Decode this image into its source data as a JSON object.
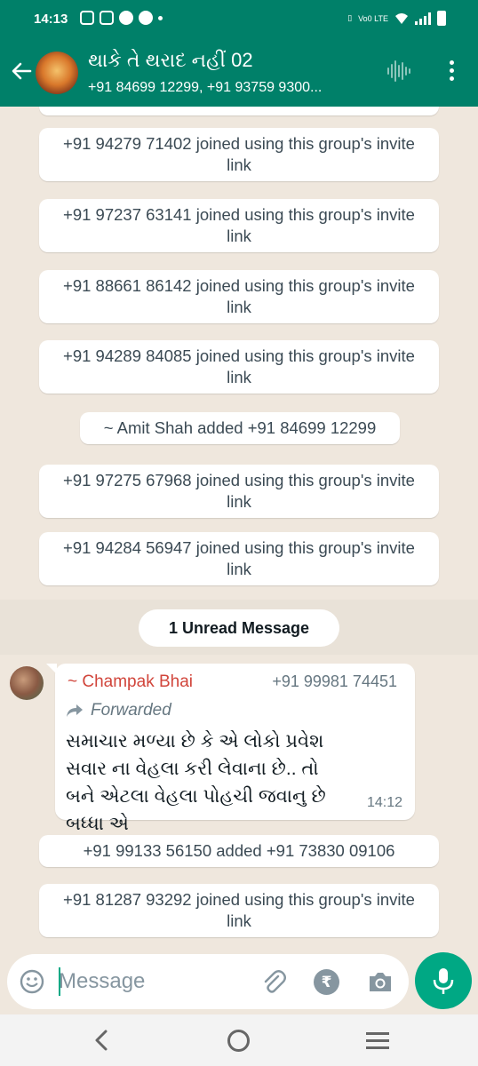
{
  "status_bar": {
    "time": "14:13",
    "network": "Vo0 LTE"
  },
  "header": {
    "title": "થાકે તે થરાદ નહીં 02",
    "subtitle": "+91 84699 12299, +91 93759 9300..."
  },
  "system_messages": [
    {
      "text": "+91 94279 71402 joined using this group's invite link"
    },
    {
      "text": "+91 97237 63141 joined using this group's invite link"
    },
    {
      "text": "+91 88661 86142 joined using this group's invite link"
    },
    {
      "text": "+91 94289 84085 joined using this group's invite link"
    },
    {
      "text": "~ Amit Shah added +91 84699 12299"
    },
    {
      "text": "+91 97275 67968 joined using this group's invite link"
    },
    {
      "text": "+91 94284 56947 joined using this group's invite link"
    },
    {
      "text": "+91 99133 56150 added +91 73830 09106"
    },
    {
      "text": "+91 81287 93292 joined using this group's invite link"
    }
  ],
  "unread_label": "1 Unread Message",
  "message": {
    "sender": "~ Champak Bhai",
    "sender_phone": "+91 99981 74451",
    "forwarded_label": "Forwarded",
    "text": "સમાચાર મળ્યા છે કે એ લોકો પ્રવેશ સવાર ના વેહલા કરી લેવાના છે.. તો બને એટલા વેહલા પોહચી જવાનુ છે બધ્ધા એ",
    "time": "14:12"
  },
  "composer": {
    "placeholder": "Message",
    "currency_symbol": "₹"
  },
  "colors": {
    "header": "#008069",
    "accent": "#00a884",
    "sender": "#d1453b",
    "chat_bg": "#efe7dd"
  }
}
